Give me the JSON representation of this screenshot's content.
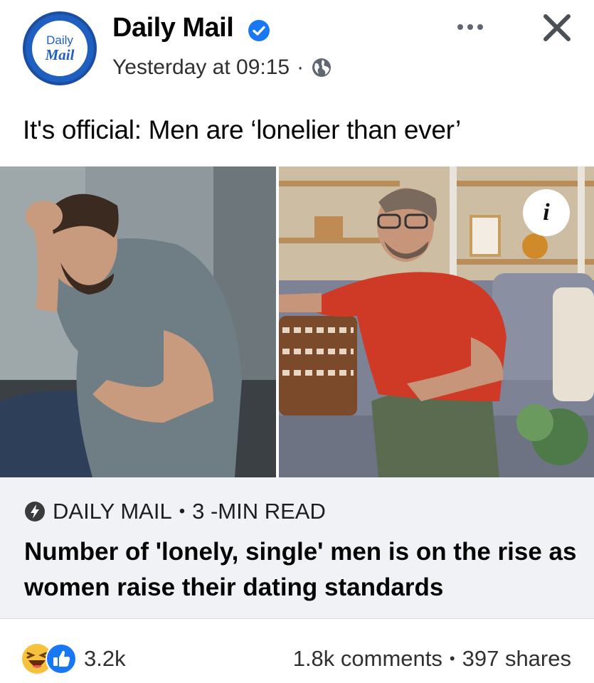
{
  "post": {
    "page_name": "Daily Mail",
    "logo": {
      "line1": "Daily",
      "line2": "Mail"
    },
    "timestamp": "Yesterday at 09:15",
    "meta_separator": "·",
    "text": "It's official: Men are ‘lonelier than ever’",
    "info_glyph": "i"
  },
  "link_preview": {
    "source": "DAILY MAIL",
    "separator": "•",
    "read_time": "3 -MIN READ",
    "title": "Number of 'lonely, single' men is on the rise as women raise their dating standards"
  },
  "footer": {
    "reaction_count": "3.2k",
    "comments": "1.8k comments",
    "separator": "•",
    "shares": "397 shares"
  },
  "colors": {
    "brand_blue": "#1f5fbf",
    "facebook_blue": "#1877f2",
    "preview_bg": "#f0f2f5"
  },
  "icons": [
    "verified-icon",
    "globe-icon",
    "more-icon",
    "close-icon",
    "info-icon",
    "bolt-icon",
    "haha-reaction-icon",
    "like-reaction-icon"
  ]
}
